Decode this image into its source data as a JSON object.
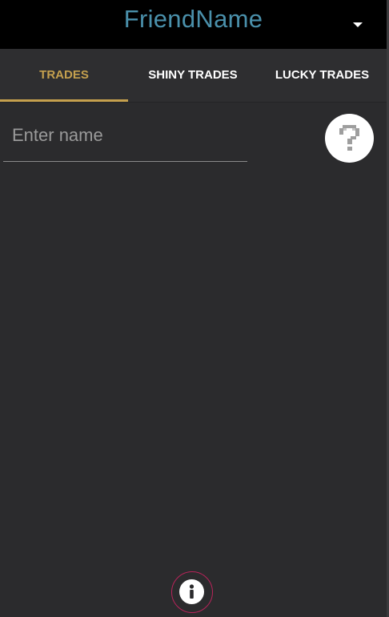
{
  "app_bar": {
    "title": "FriendName",
    "dropdown_icon": "caret-down-icon"
  },
  "tabs": [
    {
      "label": "TRADES",
      "active": true
    },
    {
      "label": "SHINY TRADES",
      "active": false
    },
    {
      "label": "LUCKY TRADES",
      "active": false
    }
  ],
  "name_field": {
    "placeholder": "Enter name",
    "value": ""
  },
  "avatar": {
    "icon": "question-mark-icon"
  },
  "info_button": {
    "icon": "info-icon"
  },
  "colors": {
    "title": "#4a90ab",
    "active_tab": "#c5a04e",
    "background": "#2b2b2d",
    "info_ring": "#b8245a"
  }
}
